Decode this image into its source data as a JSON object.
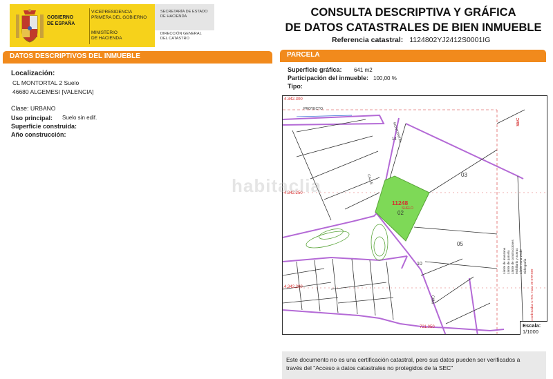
{
  "header": {
    "gobierno": [
      "GOBIERNO",
      "DE ESPAÑA"
    ],
    "vicepresidencia": [
      "VICEPRESIDENCIA",
      "PRIMERA DEL GOBIERNO"
    ],
    "ministerio": [
      "MINISTERIO",
      "DE HACIENDA"
    ],
    "secretaria": [
      "SECRETARÍA DE ESTADO",
      "DE HACIENDA"
    ],
    "direccion": [
      "DIRECCIÓN GENERAL",
      "DEL CATASTRO"
    ],
    "title_line1": "CONSULTA DESCRIPTIVA Y GRÁFICA",
    "title_line2": "DE DATOS CATASTRALES DE BIEN INMUEBLE",
    "ref_label": "Referencia catastral:",
    "ref_value": "1124802YJ2412S0001IG"
  },
  "left": {
    "section_title": "DATOS DESCRIPTIVOS DEL INMUEBLE",
    "localizacion_label": "Localización:",
    "address_line1": "CL MONTORTAL 2 Suelo",
    "address_line2": "46680 ALGEMESI [VALENCIA]",
    "clase_label": "Clase:",
    "clase_value": "URBANO",
    "uso_label": "Uso principal:",
    "uso_value": "Suelo sin edif.",
    "superficie_label": "Superficie construida:",
    "anio_label": "Año construcción:"
  },
  "right": {
    "section_title": "PARCELA",
    "superficie_label": "Superficie gráfica:",
    "superficie_value": "641 m2",
    "participacion_label": "Participación del inmueble:",
    "participacion_value": "100,00 %",
    "tipo_label": "Tipo:"
  },
  "map": {
    "coord_top": "4.342.300",
    "coord_mid": "4.342.250",
    "coord_low": "4.342.200",
    "coord_bottom": "721.050",
    "street_top": "PROYECTO",
    "street_montortal": "MONTORTAL",
    "street_calle": "CALLE",
    "street_bottom": "CAMI",
    "parcel_id": "11248",
    "parcel_sub": "SUELO",
    "parcel_02": "02",
    "parcel_03": "03",
    "parcel_05": "05",
    "num_14_top": "14",
    "num_10": "10",
    "legend_texts": [
      "Límite de manzana",
      "Límite de parcela",
      "Límite de construcciones",
      "Mobiliario y aceras",
      "Límite zona verde",
      "Hidrografía"
    ],
    "info_text": "Coordenadas U.T.M. Huso 30 ETRS89",
    "colors": {
      "parcel_green": "#7ed957",
      "block_purple": "#b46ad6",
      "red_ref": "#d53030"
    }
  },
  "scale": {
    "label": "Escala:",
    "value": "1/1000"
  },
  "note": {
    "line1": "Este documento no es una certificación catastral, pero sus datos pueden ser verificados a",
    "line2": "través del \"Acceso a datos catastrales no protegidos de la SEC\""
  },
  "watermark": "habitaclia"
}
